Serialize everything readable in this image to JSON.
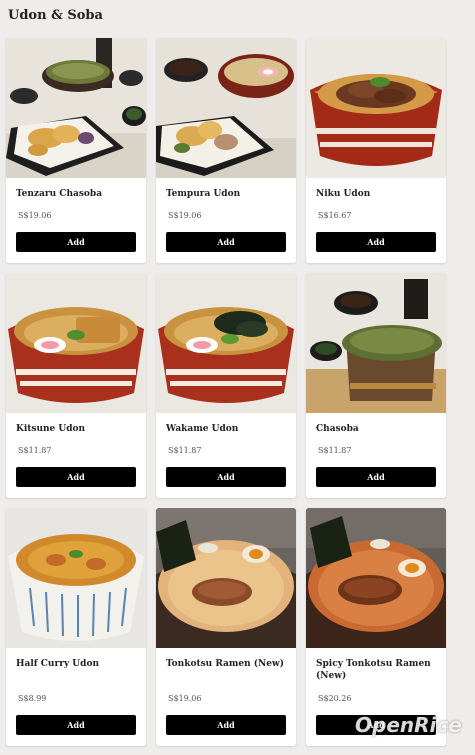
{
  "section": {
    "title": "Udon & Soba"
  },
  "items": [
    {
      "name": "Tenzaru Chasoba",
      "price": "S$19.06",
      "add_label": "Add",
      "photo": "tenzaru-chasoba-photo"
    },
    {
      "name": "Tempura Udon",
      "price": "S$19.06",
      "add_label": "Add",
      "photo": "tempura-udon-photo"
    },
    {
      "name": "Niku Udon",
      "price": "S$16.67",
      "add_label": "Add",
      "photo": "niku-udon-photo"
    },
    {
      "name": "Kitsune Udon",
      "price": "S$11.87",
      "add_label": "Add",
      "photo": "kitsune-udon-photo"
    },
    {
      "name": "Wakame Udon",
      "price": "S$11.87",
      "add_label": "Add",
      "photo": "wakame-udon-photo"
    },
    {
      "name": "Chasoba",
      "price": "S$11.87",
      "add_label": "Add",
      "photo": "chasoba-photo"
    },
    {
      "name": "Half Curry Udon",
      "price": "S$8.99",
      "add_label": "Add",
      "photo": "half-curry-udon-photo"
    },
    {
      "name": "Tonkotsu Ramen (New)",
      "price": "S$19.06",
      "add_label": "Add",
      "photo": "tonkotsu-ramen-photo"
    },
    {
      "name": "Spicy Tonkotsu Ramen (New)",
      "price": "S$20.26",
      "add_label": "Add",
      "photo": "spicy-tonkotsu-ramen-photo"
    }
  ],
  "watermark": {
    "text": "OpenRice"
  },
  "colors": {
    "add_button": "#000000",
    "background": "#efedeb",
    "card": "#ffffff"
  }
}
